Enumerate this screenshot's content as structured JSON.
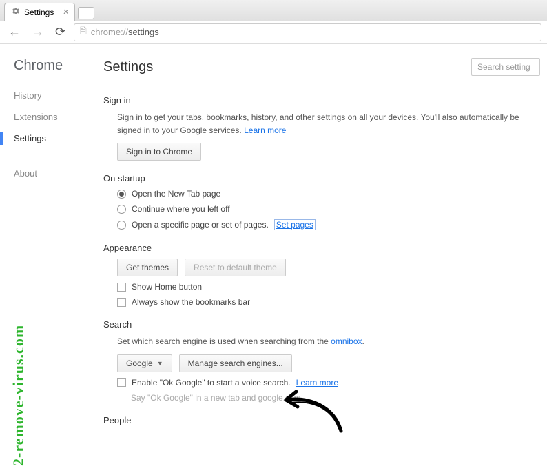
{
  "tab": {
    "title": "Settings"
  },
  "address": {
    "scheme": "chrome://",
    "path": "settings"
  },
  "sidebar": {
    "brand": "Chrome",
    "items": [
      "History",
      "Extensions",
      "Settings"
    ],
    "active_index": 2,
    "about": "About"
  },
  "page": {
    "title": "Settings",
    "search_placeholder": "Search setting"
  },
  "signin": {
    "heading": "Sign in",
    "desc": "Sign in to get your tabs, bookmarks, history, and other settings on all your devices. You'll also automatically be signed in to your Google services. ",
    "learn_more": "Learn more",
    "button": "Sign in to Chrome"
  },
  "startup": {
    "heading": "On startup",
    "options": [
      "Open the New Tab page",
      "Continue where you left off",
      "Open a specific page or set of pages."
    ],
    "selected": 0,
    "set_pages": "Set pages"
  },
  "appearance": {
    "heading": "Appearance",
    "get_themes": "Get themes",
    "reset_theme": "Reset to default theme",
    "show_home": "Show Home button",
    "show_bookmarks": "Always show the bookmarks bar"
  },
  "search": {
    "heading": "Search",
    "desc": "Set which search engine is used when searching from the ",
    "omnibox": "omnibox",
    "engine": "Google",
    "manage": "Manage search engines...",
    "ok_google": "Enable \"Ok Google\" to start a voice search. ",
    "learn_more": "Learn more",
    "hint": "Say \"Ok Google\" in a new tab and google.com"
  },
  "people": {
    "heading": "People"
  },
  "watermark": "2-remove-virus.com"
}
